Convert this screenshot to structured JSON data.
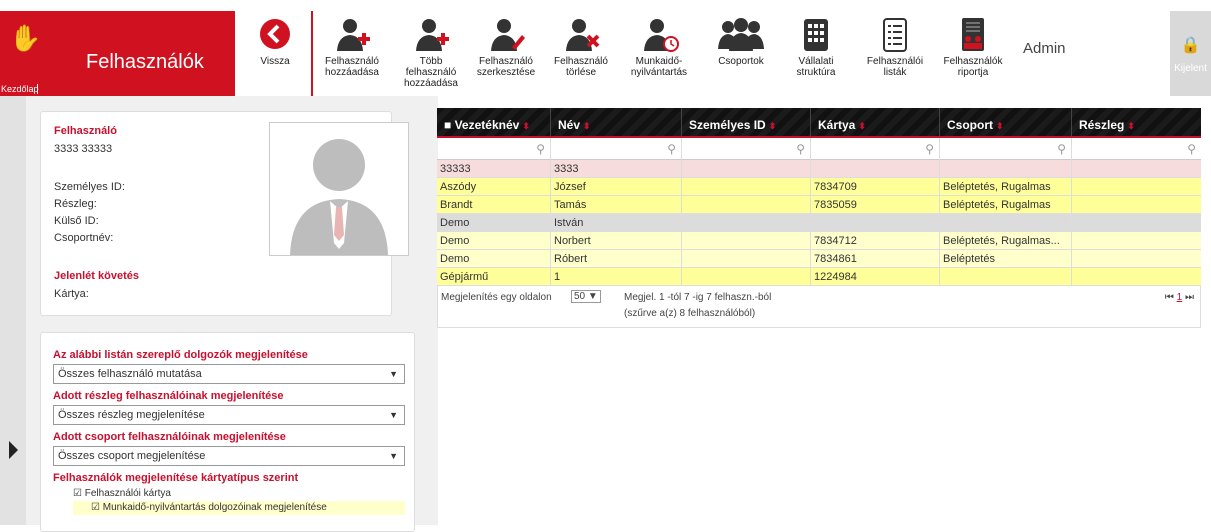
{
  "brand": {
    "title": "Felhasználók",
    "home_label": "Kezdőlap"
  },
  "toolbar": [
    {
      "id": "back",
      "label": "Vissza"
    },
    {
      "id": "add-user",
      "label": "Felhasználó hozzáadása"
    },
    {
      "id": "add-multi",
      "label": "Több felhasználó hozzáadása"
    },
    {
      "id": "edit-user",
      "label": "Felhasználó szerkesztése"
    },
    {
      "id": "delete-user",
      "label": "Felhasználó törlése"
    },
    {
      "id": "timekeeping",
      "label": "Munkaidő-nyilvántartás"
    },
    {
      "id": "groups",
      "label": "Csoportok"
    },
    {
      "id": "company",
      "label": "Vállalati struktúra"
    },
    {
      "id": "user-lists",
      "label": "Felhasználói listák"
    },
    {
      "id": "report",
      "label": "Felhasználók riportja"
    }
  ],
  "admin_label": "Admin",
  "logout_label": "Kijelent",
  "user_card": {
    "heading": "Felhasználó",
    "name": "3333 33333",
    "fields": [
      "Személyes ID:",
      "Részleg:",
      "Külső ID:",
      "Csoportnév:"
    ],
    "attendance_heading": "Jelenlét követés",
    "card_label": "Kártya:"
  },
  "filters": {
    "list_heading": "Az alábbi listán szereplő dolgozók megjelenítése",
    "list_value": "Összes felhasználó mutatása",
    "dept_heading": "Adott részleg felhasználóinak megjelenítése",
    "dept_value": "Összes részleg megjelenítése",
    "group_heading": "Adott csoport felhasználóinak megjelenítése",
    "group_value": "Összes csoport megjelenítése",
    "cardtype_heading": "Felhasználók megjelenítése kártyatípus szerint",
    "cb1": "Felhasználói kártya",
    "cb2": "Munkaidő-nyilvántartás dolgozóinak megjelenítése"
  },
  "table": {
    "headers": [
      "Vezetéknév",
      "Név",
      "Személyes ID",
      "Kártya",
      "Csoport",
      "Részleg"
    ],
    "rows": [
      {
        "cells": [
          "33333",
          "3333",
          "",
          "",
          "",
          ""
        ],
        "bg": "#f6dcdc"
      },
      {
        "cells": [
          "Aszódy",
          "József",
          "",
          "7834709",
          "Beléptetés, Rugalmas",
          ""
        ],
        "bg": "#ffff99"
      },
      {
        "cells": [
          "Brandt",
          "Tamás",
          "",
          "7835059",
          "Beléptetés, Rugalmas",
          ""
        ],
        "bg": "#ffff99"
      },
      {
        "cells": [
          "Demo",
          "István",
          "",
          "",
          "",
          ""
        ],
        "bg": "#dcdcdc"
      },
      {
        "cells": [
          "Demo",
          "Norbert",
          "",
          "7834712",
          "Beléptetés, Rugalmas...",
          ""
        ],
        "bg": "#ffffcc"
      },
      {
        "cells": [
          "Demo",
          "Róbert",
          "",
          "7834861",
          "Beléptetés",
          ""
        ],
        "bg": "#ffffcc"
      },
      {
        "cells": [
          "Gépjármű",
          "1",
          "",
          "1224984",
          "",
          ""
        ],
        "bg": "#ffff99"
      }
    ],
    "per_page_label": "Megjelenítés egy oldalon",
    "per_page_value": "50",
    "info_line1": "Megjel. 1 -tól 7 -ig 7 felhaszn.-ból",
    "info_line2": "(szűrve a(z) 8 felhasználóból)",
    "pager_page": "1"
  },
  "colors": {
    "accent": "#d0111f"
  }
}
